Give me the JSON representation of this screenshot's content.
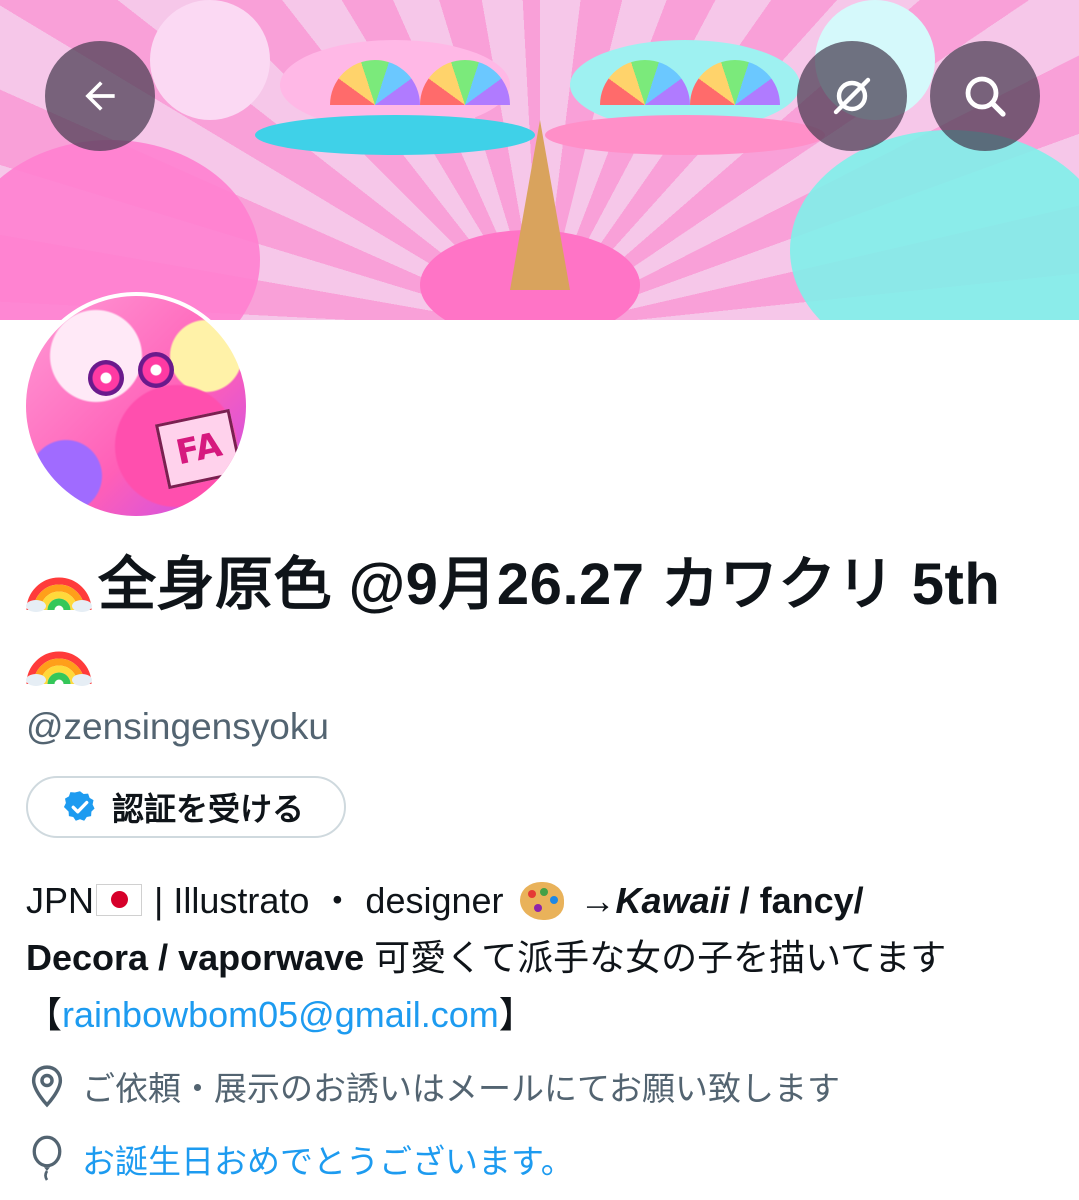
{
  "header": {
    "back_icon": "arrow-left-icon",
    "link_off_icon": "link-off-icon",
    "search_icon": "search-icon",
    "button_bg": "#463c50"
  },
  "profile": {
    "display_name": "全身原色 @9月26.27 カワクリ 5th",
    "name_emoji": "🌈",
    "handle": "@zensingensyoku",
    "verify_label": "認証を受ける",
    "verify_icon": "verified-badge-icon",
    "bio": {
      "jpn": "JPN",
      "flag_icon": "japan-flag-icon",
      "sep1": " | Illustrato ・ designer ",
      "palette_icon": "artist-palette-icon",
      "arrow": " →",
      "kawaii": "Kawaii",
      "styles_1": " / fancy/",
      "styles_2": "Decora / vaporwave",
      "jp_text": " 可愛くて派手な女の子を描いてます",
      "email_open": "【",
      "email": "rainbowbom05@gmail.com",
      "email_close": "】"
    },
    "location_icon": "location-pin-icon",
    "location": "ご依頼・展示のお誘いはメールにてお願い致します",
    "birthday_icon": "balloon-icon",
    "birthday": "お誕生日おめでとうございます。"
  },
  "colors": {
    "link": "#1d9bf0",
    "secondary_text": "#536471",
    "text": "#0f1419",
    "border": "#cfd9de"
  }
}
